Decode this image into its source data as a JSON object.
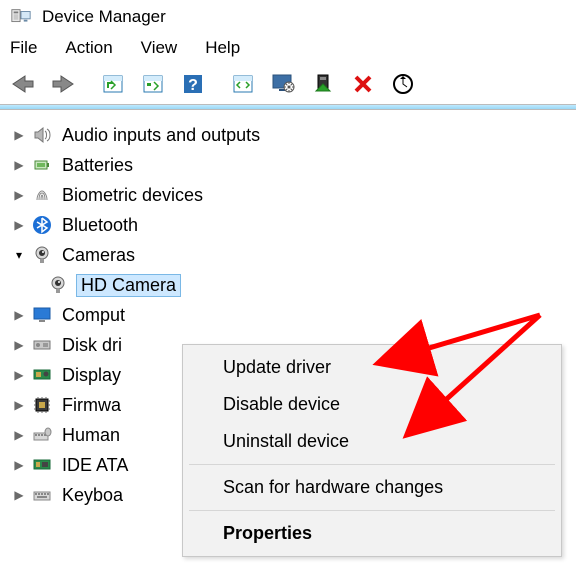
{
  "window": {
    "title": "Device Manager"
  },
  "menubar": {
    "items": [
      "File",
      "Action",
      "View",
      "Help"
    ]
  },
  "toolbar": {
    "buttons": [
      "back",
      "forward",
      "sep",
      "show-hidden",
      "properties-sheet",
      "help",
      "sep",
      "scan",
      "monitor-config",
      "update-driver",
      "delete",
      "refresh"
    ]
  },
  "tree": {
    "nodes": [
      {
        "icon": "speaker",
        "label": "Audio inputs and outputs",
        "expanded": false
      },
      {
        "icon": "battery",
        "label": "Batteries",
        "expanded": false
      },
      {
        "icon": "fingerprint",
        "label": "Biometric devices",
        "expanded": false
      },
      {
        "icon": "bluetooth",
        "label": "Bluetooth",
        "expanded": false
      },
      {
        "icon": "camera",
        "label": "Cameras",
        "expanded": true,
        "children": [
          {
            "icon": "camera",
            "label": "HD Camera",
            "selected": true
          }
        ]
      },
      {
        "icon": "monitor",
        "label": "Computer",
        "expanded": false,
        "truncated": "Comput"
      },
      {
        "icon": "disk",
        "label": "Disk drives",
        "expanded": false,
        "truncated": "Disk dri"
      },
      {
        "icon": "gpu",
        "label": "Display adapters",
        "expanded": false,
        "truncated": "Display"
      },
      {
        "icon": "chip",
        "label": "Firmware",
        "expanded": false,
        "truncated": "Firmwa"
      },
      {
        "icon": "keyboard2",
        "label": "Human Interface Devices",
        "expanded": false,
        "truncated": "Human"
      },
      {
        "icon": "ide",
        "label": "IDE ATA/ATAPI controllers",
        "expanded": false,
        "truncated": "IDE ATA"
      },
      {
        "icon": "keyboard",
        "label": "Keyboards",
        "expanded": false,
        "truncated": "Keyboa"
      }
    ]
  },
  "context_menu": {
    "items": [
      {
        "label": "Update driver",
        "bold": false
      },
      {
        "label": "Disable device",
        "bold": false
      },
      {
        "label": "Uninstall device",
        "bold": false
      },
      {
        "separator": true
      },
      {
        "label": "Scan for hardware changes",
        "bold": false
      },
      {
        "separator": true
      },
      {
        "label": "Properties",
        "bold": true
      }
    ]
  },
  "annotations": {
    "arrow1_target": "Update driver",
    "arrow2_target": "Uninstall device"
  }
}
